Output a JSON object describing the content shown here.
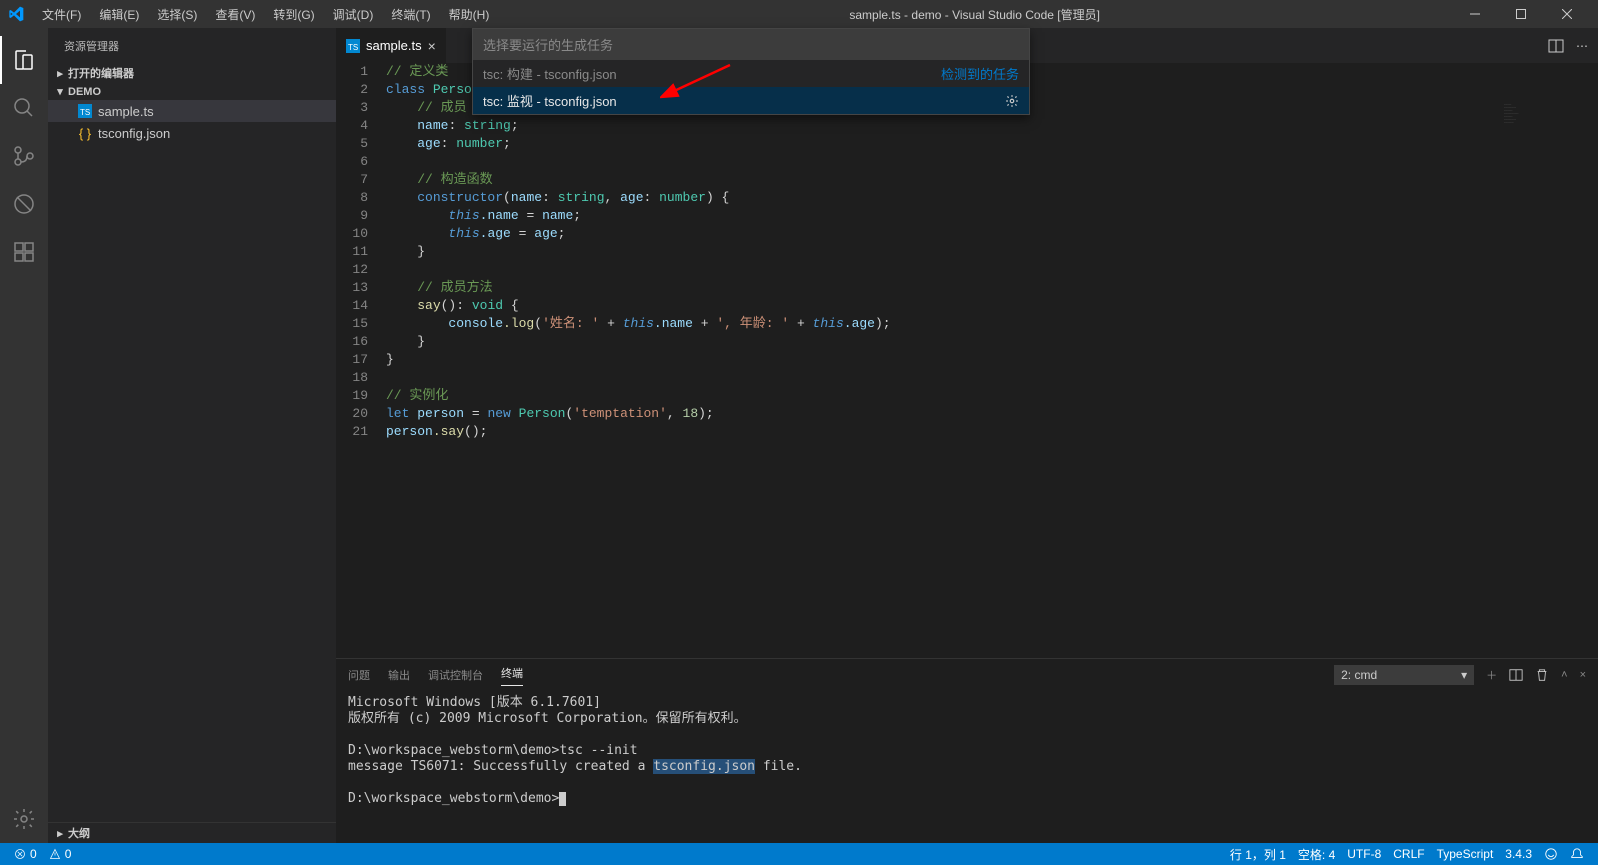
{
  "window": {
    "title": "sample.ts - demo - Visual Studio Code [管理员]"
  },
  "menu": {
    "file": "文件(F)",
    "edit": "编辑(E)",
    "select": "选择(S)",
    "view": "查看(V)",
    "goto": "转到(G)",
    "debug": "调试(D)",
    "terminal": "终端(T)",
    "help": "帮助(H)"
  },
  "sidebar": {
    "title": "资源管理器",
    "sections": {
      "openEditors": "打开的编辑器",
      "demo": "DEMO",
      "outline": "大纲"
    },
    "files": {
      "sample": "sample.ts",
      "tsconfig": "tsconfig.json"
    }
  },
  "tabs": {
    "sample": "sample.ts"
  },
  "quickpick": {
    "placeholder": "选择要运行的生成任务",
    "task_build": "tsc: 构建 - tsconfig.json",
    "detected": "检测到的任务",
    "task_watch": "tsc: 监视 - tsconfig.json"
  },
  "code": {
    "lines": [
      "1",
      "2",
      "3",
      "4",
      "5",
      "6",
      "7",
      "8",
      "9",
      "10",
      "11",
      "12",
      "13",
      "14",
      "15",
      "16",
      "17",
      "18",
      "19",
      "20",
      "21"
    ],
    "l1_comment": "// 定义类",
    "l2_class": "class ",
    "l2_name": "Perso",
    "l3_comment": "// 成员",
    "l4_name": "name",
    "l4_colon": ": ",
    "l4_type": "string",
    "l4_semi": ";",
    "l5_name": "age",
    "l5_type": "number",
    "l7_comment": "// 构造函数",
    "l8_ctor": "constructor",
    "l8_p1": "name",
    "l8_t1": "string",
    "l8_p2": "age",
    "l8_t2": "number",
    "l9_this": "this",
    "l9_prop": ".name",
    "l9_eq": " = ",
    "l9_val": "name",
    "l10_prop": ".age",
    "l10_val": "age",
    "l13_comment": "// 成员方法",
    "l14_say": "say",
    "l14_void": "void",
    "l15_console": "console",
    "l15_log": ".log",
    "l15_s1": "'姓名: '",
    "l15_plus": " + ",
    "l15_this": "this",
    "l15_name": ".name",
    "l15_s2": "', 年龄: '",
    "l15_age": ".age",
    "l19_comment": "// 实例化",
    "l20_let": "let ",
    "l20_var": "person",
    "l20_new": "new ",
    "l20_class": "Person",
    "l20_str": "'temptation'",
    "l20_num": "18",
    "l21_person": "person",
    "l21_say": ".say"
  },
  "panel": {
    "tabs": {
      "problems": "问题",
      "output": "输出",
      "debugconsole": "调试控制台",
      "terminal": "终端"
    },
    "select": "2: cmd",
    "terminal_l1": "Microsoft Windows [版本 6.1.7601]",
    "terminal_l2": "版权所有 (c) 2009 Microsoft Corporation。保留所有权利。",
    "terminal_l3_prompt": "D:\\workspace_webstorm\\demo>",
    "terminal_l3_cmd": "tsc --init",
    "terminal_l4_a": "message TS6071: Successfully created a ",
    "terminal_l4_hl": "tsconfig.json",
    "terminal_l4_b": " file.",
    "terminal_l5": "D:\\workspace_webstorm\\demo>"
  },
  "statusbar": {
    "errors": "0",
    "warnings": "0",
    "ln_col": "行 1，列 1",
    "spaces": "空格: 4",
    "encoding": "UTF-8",
    "eol": "CRLF",
    "lang": "TypeScript",
    "ts_version": "3.4.3"
  }
}
